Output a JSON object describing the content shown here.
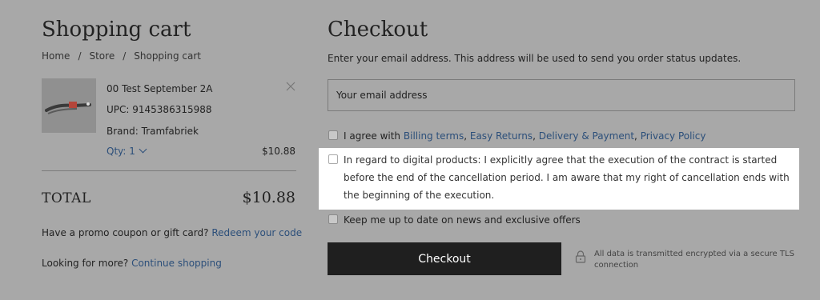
{
  "cart": {
    "title": "Shopping cart",
    "breadcrumb": [
      "Home",
      "Store",
      "Shopping cart"
    ],
    "breadcrumb_sep": "/",
    "item": {
      "name": "00 Test September 2A",
      "upc": "UPC: 9145386315988",
      "brand": "Brand: Tramfabriek",
      "qty": "Qty: 1",
      "price": "$10.88"
    },
    "total_label": "TOTAL",
    "total_amount": "$10.88",
    "promo_text": "Have a promo coupon or gift card?",
    "promo_link": "Redeem your code",
    "more_text": "Looking for more?",
    "more_link": "Continue shopping"
  },
  "checkout": {
    "title": "Checkout",
    "info": "Enter your email address. This address will be used to send you order status updates.",
    "email_placeholder": "Your email address",
    "agree_prefix": "I agree with",
    "terms": [
      "Billing terms",
      "Easy Returns",
      "Delivery & Payment",
      "Privacy Policy"
    ],
    "digital_text": "In regard to digital products: I explicitly agree that the execution of the contract is started before the end of the cancellation period. I am aware that my right of cancellation ends with the beginning of the execution.",
    "news_text": "Keep me up to date on news and exclusive offers",
    "button": "Checkout",
    "secure_text": "All data is transmitted encrypted via a secure TLS connection"
  }
}
